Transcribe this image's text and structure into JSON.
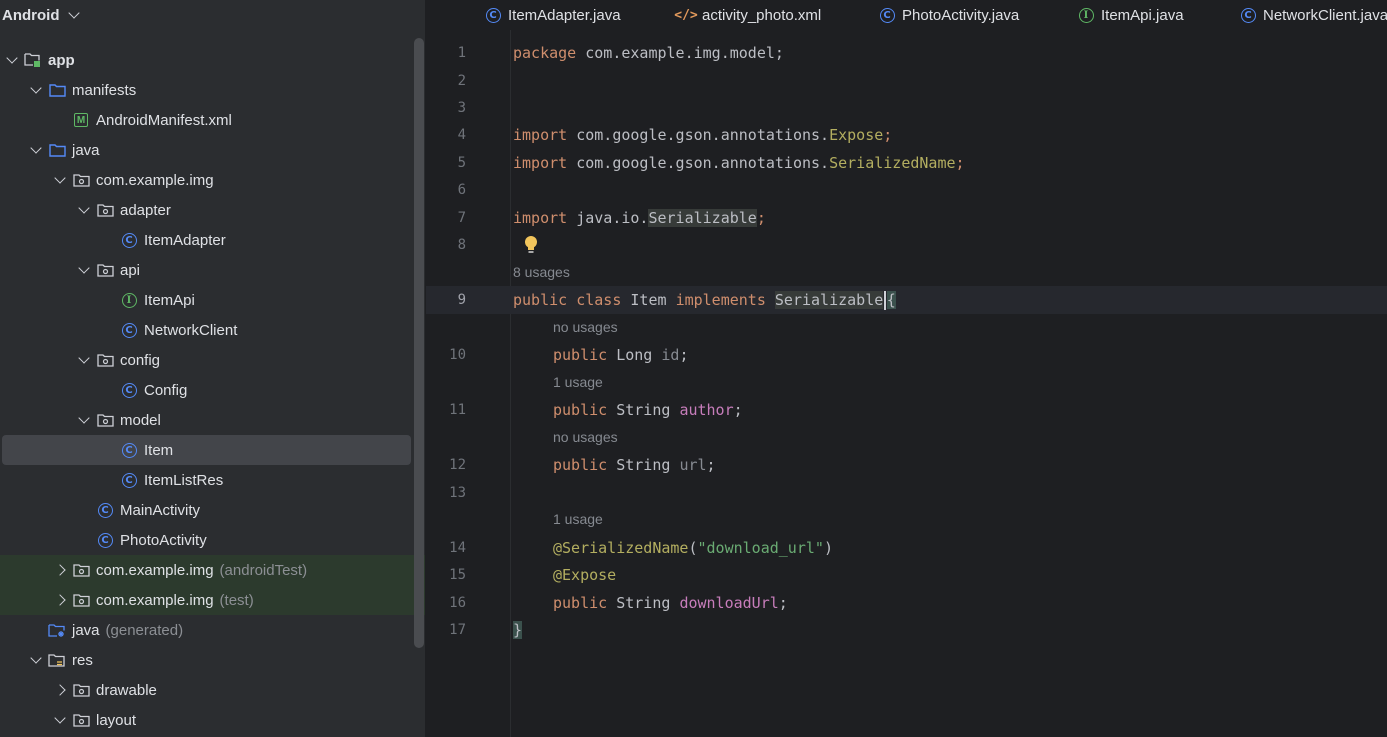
{
  "project": {
    "view_label": "Android",
    "tree": [
      {
        "label": "app",
        "bold": true,
        "icon": "module-folder-icon",
        "twisty": "down",
        "depth": 0
      },
      {
        "label": "manifests",
        "icon": "folder-icon",
        "twisty": "down",
        "depth": 1
      },
      {
        "label": "AndroidManifest.xml",
        "icon": "manifest-icon",
        "twisty": "none",
        "depth": 2
      },
      {
        "label": "java",
        "icon": "folder-icon",
        "twisty": "down",
        "depth": 1
      },
      {
        "label": "com.example.img",
        "icon": "package-icon",
        "twisty": "down",
        "depth": 2
      },
      {
        "label": "adapter",
        "icon": "package-icon",
        "twisty": "down",
        "depth": 3
      },
      {
        "label": "ItemAdapter",
        "icon": "class-icon",
        "twisty": "none",
        "depth": 4
      },
      {
        "label": "api",
        "icon": "package-icon",
        "twisty": "down",
        "depth": 3
      },
      {
        "label": "ItemApi",
        "icon": "interface-icon",
        "twisty": "none",
        "depth": 4
      },
      {
        "label": "NetworkClient",
        "icon": "class-icon",
        "twisty": "none",
        "depth": 4
      },
      {
        "label": "config",
        "icon": "package-icon",
        "twisty": "down",
        "depth": 3
      },
      {
        "label": "Config",
        "icon": "class-icon",
        "twisty": "none",
        "depth": 4
      },
      {
        "label": "model",
        "icon": "package-icon",
        "twisty": "down",
        "depth": 3
      },
      {
        "label": "Item",
        "icon": "class-icon",
        "twisty": "none",
        "depth": 4,
        "selected": true
      },
      {
        "label": "ItemListRes",
        "icon": "class-icon",
        "twisty": "none",
        "depth": 4
      },
      {
        "label": "MainActivity",
        "icon": "class-icon",
        "twisty": "none",
        "depth": 3
      },
      {
        "label": "PhotoActivity",
        "icon": "class-icon",
        "twisty": "none",
        "depth": 3
      },
      {
        "label": "com.example.img",
        "suffix": "(androidTest)",
        "icon": "package-icon",
        "twisty": "right",
        "depth": 2,
        "test": true
      },
      {
        "label": "com.example.img",
        "suffix": "(test)",
        "icon": "package-icon",
        "twisty": "right",
        "depth": 2,
        "test": true
      },
      {
        "label": "java",
        "suffix": "(generated)",
        "icon": "generated-folder-icon",
        "twisty": "none",
        "depth": 1
      },
      {
        "label": "res",
        "icon": "resource-folder-icon",
        "twisty": "down",
        "depth": 1
      },
      {
        "label": "drawable",
        "icon": "package-icon",
        "twisty": "right",
        "depth": 2
      },
      {
        "label": "layout",
        "icon": "package-icon",
        "twisty": "down",
        "depth": 2
      }
    ]
  },
  "tabs": [
    {
      "label": "ItemAdapter.java",
      "icon": "class-icon"
    },
    {
      "label": "activity_photo.xml",
      "icon": "xml-icon"
    },
    {
      "label": "PhotoActivity.java",
      "icon": "class-icon"
    },
    {
      "label": "ItemApi.java",
      "icon": "interface-icon"
    },
    {
      "label": "NetworkClient.java",
      "icon": "class-icon"
    }
  ],
  "editor": {
    "line_numbers": [
      "1",
      "2",
      "3",
      "4",
      "5",
      "6",
      "7",
      "8",
      "9",
      "10",
      "11",
      "12",
      "13",
      "14",
      "15",
      "16",
      "17"
    ],
    "hints": {
      "class_usages": "8 usages",
      "id_usages": "no usages",
      "author_usages": "1 usage",
      "url_usages": "no usages",
      "download_usages": "1 usage"
    },
    "code": {
      "l1_kw": "package",
      "l1_rest": " com.example.img.model;",
      "l4_kw": "import",
      "l4_pkg": " com.google.gson.annotations.",
      "l4_cls": "Expose",
      "l4_end": ";",
      "l5_kw": "import",
      "l5_pkg": " com.google.gson.annotations.",
      "l5_cls": "SerializedName",
      "l5_end": ";",
      "l7_kw": "import",
      "l7_pkg": " java.io.",
      "l7_cls": "Serializable",
      "l7_end": ";",
      "l9_kw1": "public",
      "l9_kw2": "class",
      "l9_name": "Item",
      "l9_kw3": "implements",
      "l9_iface": "Serializable",
      "l9_brace": "{",
      "l10_kw": "public",
      "l10_type": "Long",
      "l10_field": "id",
      "l11_kw": "public",
      "l11_type": "String",
      "l11_field": "author",
      "l12_kw": "public",
      "l12_type": "String",
      "l12_field": "url",
      "l14_ann": "@SerializedName",
      "l14_open": "(",
      "l14_str": "\"download_url\"",
      "l14_close": ")",
      "l15_ann": "@Expose",
      "l16_kw": "public",
      "l16_type": "String",
      "l16_field": "downloadUrl",
      "l17": "}"
    }
  },
  "colors": {
    "keyword": "#cf8e6d",
    "annotation": "#b3ae60",
    "field": "#c77dbb",
    "string": "#6aab73",
    "class_icon": "#548af7",
    "interface_icon": "#5fb865"
  }
}
